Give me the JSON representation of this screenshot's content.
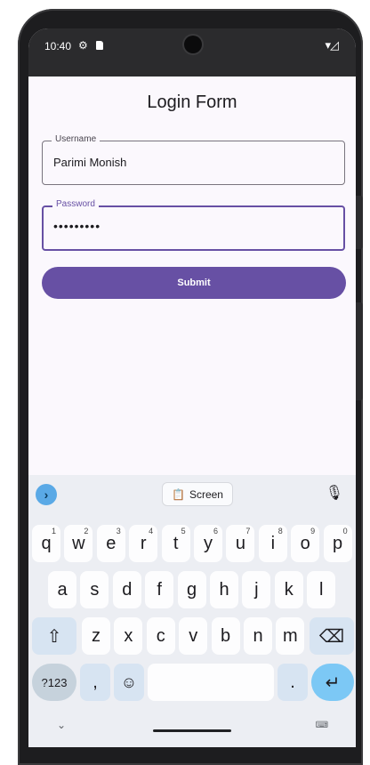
{
  "status_bar": {
    "time": "10:40",
    "settings_icon": "⚙",
    "wifi_signal": "▾◿"
  },
  "app": {
    "title": "Login Form",
    "username": {
      "label": "Username",
      "value": "Parimi Monish"
    },
    "password": {
      "label": "Password",
      "value": "•••••••••"
    },
    "submit_label": "Submit"
  },
  "keyboard": {
    "toolbar": {
      "expand": "›",
      "chip_label": "Screen",
      "chip_icon": "📋",
      "mic_icon": "🎙"
    },
    "row1": [
      {
        "k": "q",
        "h": "1"
      },
      {
        "k": "w",
        "h": "2"
      },
      {
        "k": "e",
        "h": "3"
      },
      {
        "k": "r",
        "h": "4"
      },
      {
        "k": "t",
        "h": "5"
      },
      {
        "k": "y",
        "h": "6"
      },
      {
        "k": "u",
        "h": "7"
      },
      {
        "k": "i",
        "h": "8"
      },
      {
        "k": "o",
        "h": "9"
      },
      {
        "k": "p",
        "h": "0"
      }
    ],
    "row2": [
      "a",
      "s",
      "d",
      "f",
      "g",
      "h",
      "j",
      "k",
      "l"
    ],
    "row3": [
      "z",
      "x",
      "c",
      "v",
      "b",
      "n",
      "m"
    ],
    "shift": "⇧",
    "backspace": "⌫",
    "symbols": "?123",
    "comma": ",",
    "emoji": "☺",
    "period": ".",
    "enter": "↵",
    "hide": "⌄",
    "switch": "⌨"
  },
  "colors": {
    "primary": "#6750a4",
    "background": "#fbf8fd",
    "keyboard_bg": "#eceef3",
    "enter_key": "#7cc8f5"
  }
}
